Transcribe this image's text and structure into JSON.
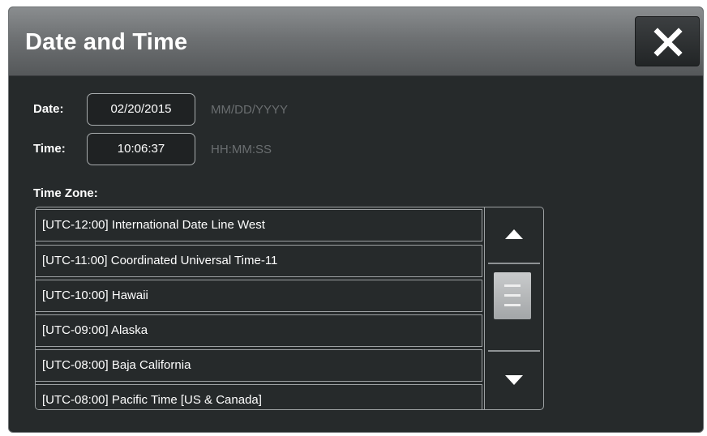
{
  "dialog": {
    "title": "Date and Time",
    "close_icon": "close-icon"
  },
  "date": {
    "label": "Date:",
    "value": "02/20/2015",
    "format_hint": "MM/DD/YYYY"
  },
  "time": {
    "label": "Time:",
    "value": "10:06:37",
    "format_hint": "HH:MM:SS"
  },
  "timezone": {
    "label": "Time Zone:",
    "items": [
      {
        "label": "[UTC-12:00] International Date Line West"
      },
      {
        "label": "[UTC-11:00] Coordinated Universal Time-11"
      },
      {
        "label": "[UTC-10:00] Hawaii"
      },
      {
        "label": "[UTC-09:00] Alaska"
      },
      {
        "label": "[UTC-08:00] Baja California"
      },
      {
        "label": "[UTC-08:00] Pacific Time [US & Canada]"
      }
    ],
    "scroll_up_icon": "triangle-up-icon",
    "scroll_down_icon": "triangle-down-icon",
    "scroll_thumb_icon": "grip-icon"
  },
  "colors": {
    "background": "#262a2b",
    "titlebar": "#6e7173",
    "border": "#9da1a3",
    "hint_text": "#6a6e70"
  }
}
